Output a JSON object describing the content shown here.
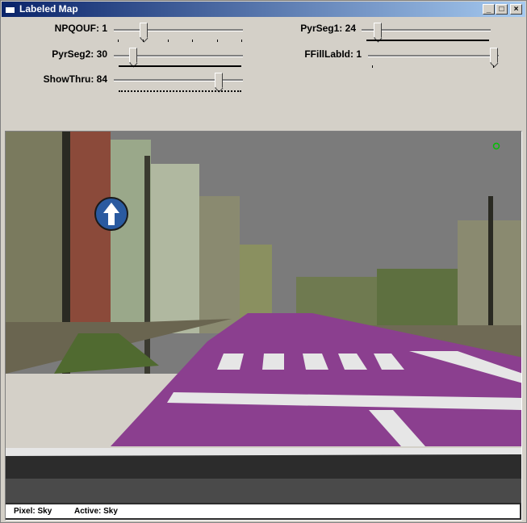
{
  "window": {
    "title": "Labeled Map"
  },
  "titlebar_buttons": {
    "minimize": "_",
    "maximize": "□",
    "close": "×"
  },
  "controls": [
    {
      "label": "NPQOUF: 1",
      "value": 1
    },
    {
      "label": "PyrSeg1: 24",
      "value": 24
    },
    {
      "label": "PyrSeg2: 30",
      "value": 30
    },
    {
      "label": "FFillLabId: 1",
      "value": 1
    },
    {
      "label": "ShowThru: 84",
      "value": 84
    }
  ],
  "status": {
    "pixel": "Pixel:  Sky",
    "active": "Active:  Sky"
  },
  "colors": {
    "sky": "#7b7b7b",
    "road_label": "#8b3f8f",
    "marking": "#e6e6e6",
    "vegetation": "#8a9a40",
    "building": "#6a6550",
    "overlay_marker": "#00c000"
  },
  "icons": [
    "labeled-map-app-icon",
    "minimize-icon",
    "maximize-icon",
    "close-icon",
    "direction-arrow-sign-icon"
  ]
}
